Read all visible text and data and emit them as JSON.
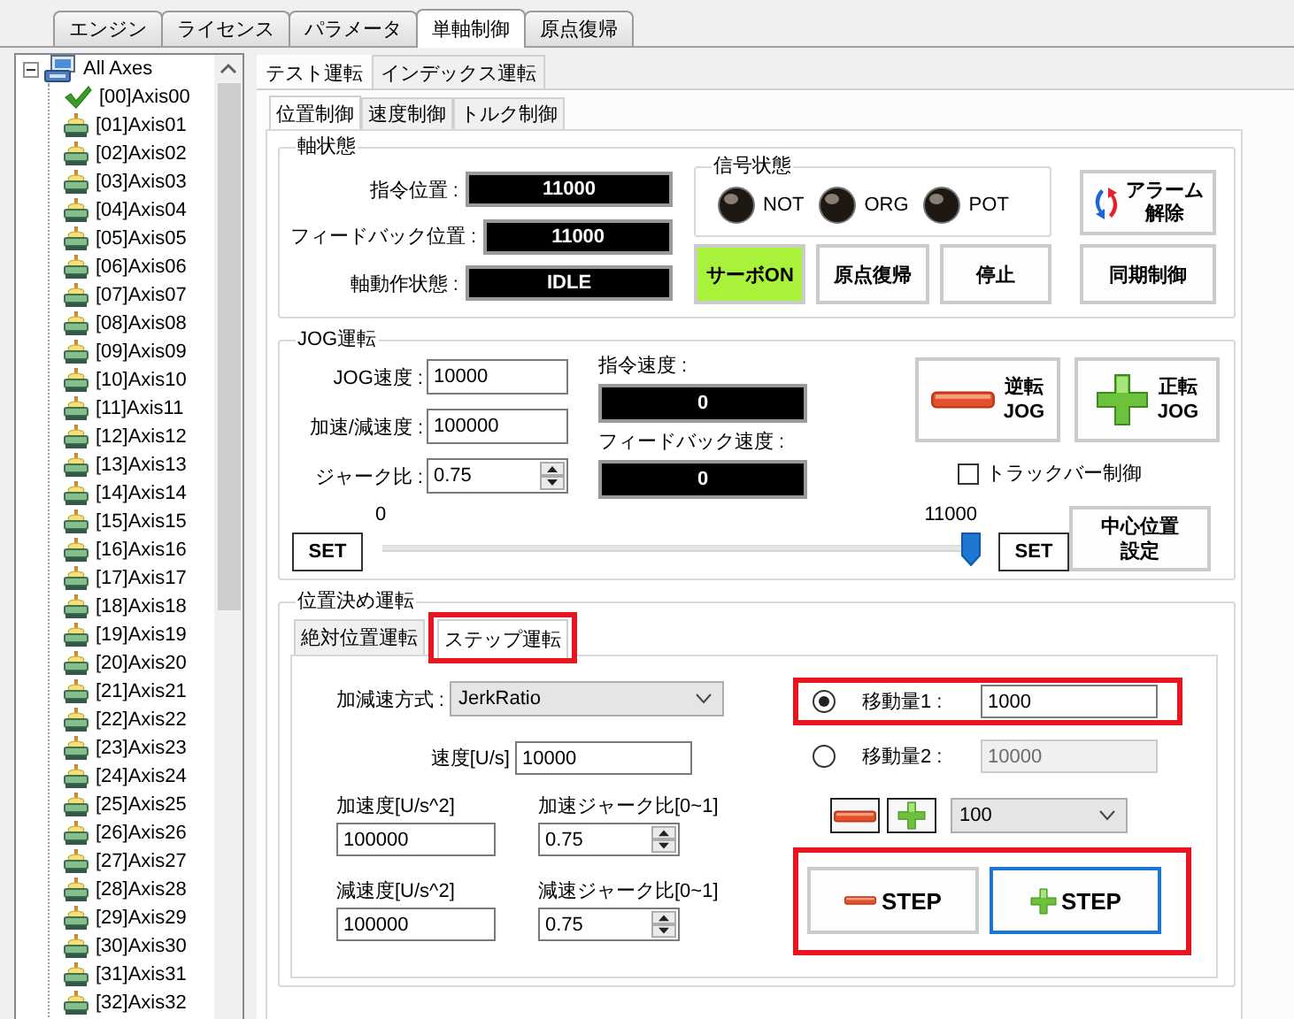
{
  "main_tabs": [
    {
      "label": "エンジン",
      "selected": false
    },
    {
      "label": "ライセンス",
      "selected": false
    },
    {
      "label": "パラメータ",
      "selected": false
    },
    {
      "label": "単軸制御",
      "selected": true
    },
    {
      "label": "原点復帰",
      "selected": false
    }
  ],
  "axis_tree": {
    "label": "All Axes",
    "expanded": true,
    "children": [
      {
        "label": "[00]Axis00",
        "kind": "active"
      },
      {
        "label": "[01]Axis01",
        "kind": "axis"
      },
      {
        "label": "[02]Axis02",
        "kind": "axis"
      },
      {
        "label": "[03]Axis03",
        "kind": "axis"
      },
      {
        "label": "[04]Axis04",
        "kind": "axis"
      },
      {
        "label": "[05]Axis05",
        "kind": "axis"
      },
      {
        "label": "[06]Axis06",
        "kind": "axis"
      },
      {
        "label": "[07]Axis07",
        "kind": "axis"
      },
      {
        "label": "[08]Axis08",
        "kind": "axis"
      },
      {
        "label": "[09]Axis09",
        "kind": "axis"
      },
      {
        "label": "[10]Axis10",
        "kind": "axis"
      },
      {
        "label": "[11]Axis11",
        "kind": "axis"
      },
      {
        "label": "[12]Axis12",
        "kind": "axis"
      },
      {
        "label": "[13]Axis13",
        "kind": "axis"
      },
      {
        "label": "[14]Axis14",
        "kind": "axis"
      },
      {
        "label": "[15]Axis15",
        "kind": "axis"
      },
      {
        "label": "[16]Axis16",
        "kind": "axis"
      },
      {
        "label": "[17]Axis17",
        "kind": "axis"
      },
      {
        "label": "[18]Axis18",
        "kind": "axis"
      },
      {
        "label": "[19]Axis19",
        "kind": "axis"
      },
      {
        "label": "[20]Axis20",
        "kind": "axis"
      },
      {
        "label": "[21]Axis21",
        "kind": "axis"
      },
      {
        "label": "[22]Axis22",
        "kind": "axis"
      },
      {
        "label": "[23]Axis23",
        "kind": "axis"
      },
      {
        "label": "[24]Axis24",
        "kind": "axis"
      },
      {
        "label": "[25]Axis25",
        "kind": "axis"
      },
      {
        "label": "[26]Axis26",
        "kind": "axis"
      },
      {
        "label": "[27]Axis27",
        "kind": "axis"
      },
      {
        "label": "[28]Axis28",
        "kind": "axis"
      },
      {
        "label": "[29]Axis29",
        "kind": "axis"
      },
      {
        "label": "[30]Axis30",
        "kind": "axis"
      },
      {
        "label": "[31]Axis31",
        "kind": "axis"
      },
      {
        "label": "[32]Axis32",
        "kind": "axis"
      }
    ]
  },
  "mode_tabs": [
    {
      "label": "テスト運転",
      "selected": true
    },
    {
      "label": "インデックス運転",
      "selected": false
    }
  ],
  "control_tabs": [
    {
      "label": "位置制御",
      "selected": true
    },
    {
      "label": "速度制御",
      "selected": false
    },
    {
      "label": "トルク制御",
      "selected": false
    }
  ],
  "axis_status": {
    "title": "軸状態",
    "readouts": [
      {
        "label": "指令位置 :",
        "value": "11000"
      },
      {
        "label": "フィードバック位置 :",
        "value": "11000"
      },
      {
        "label": "軸動作状態 :",
        "value": "IDLE"
      }
    ],
    "signals": {
      "title": "信号状態",
      "lamps": [
        {
          "label": "NOT",
          "on": false
        },
        {
          "label": "ORG",
          "on": false
        },
        {
          "label": "POT",
          "on": false
        }
      ]
    },
    "buttons": [
      {
        "label": "サーボON",
        "on": true
      },
      {
        "label": "原点復帰",
        "on": false
      },
      {
        "label": "停止",
        "on": false
      }
    ],
    "alarm_button": {
      "lines": [
        "アラーム",
        "解除"
      ]
    },
    "sync_button": {
      "label": "同期制御"
    }
  },
  "jog": {
    "title": "JOG運転",
    "fields": [
      {
        "label": "JOG速度 :",
        "value": "10000",
        "kind": "text"
      },
      {
        "label": "加速/減速度 :",
        "value": "100000",
        "kind": "text"
      },
      {
        "label": "ジャーク比 :",
        "value": "0.75",
        "kind": "spin"
      }
    ],
    "readouts": [
      {
        "label": "指令速度 :",
        "value": "0"
      },
      {
        "label": "フィードバック速度 :",
        "value": "0"
      }
    ],
    "jog_buttons": [
      {
        "kind": "reverse",
        "lines": [
          "逆転",
          "JOG"
        ]
      },
      {
        "kind": "forward",
        "lines": [
          "正転",
          "JOG"
        ]
      }
    ],
    "trackbar_control": {
      "label": "トラックバー制御",
      "checked": false
    },
    "slider": {
      "min_label": "0",
      "max_label": "11000",
      "level": 0.99
    },
    "set_buttons": [
      "SET",
      "SET"
    ],
    "center_button": {
      "lines": [
        "中心位置",
        "設定"
      ]
    }
  },
  "positioning": {
    "title": "位置決め運転",
    "tabs": [
      {
        "label": "絶対位置運転",
        "selected": false,
        "highlighted": false
      },
      {
        "label": "ステップ運転",
        "selected": true,
        "highlighted": true
      }
    ],
    "accel_mode": {
      "label": "加減速方式 :",
      "value": "JerkRatio"
    },
    "speed": {
      "label": "速度[U/s]",
      "value": "10000"
    },
    "accel": {
      "label": "加速度[U/s^2]",
      "value": "100000"
    },
    "accel_jerk": {
      "label": "加速ジャーク比[0~1]",
      "value": "0.75"
    },
    "decel": {
      "label": "減速度[U/s^2]",
      "value": "100000"
    },
    "decel_jerk": {
      "label": "減速ジャーク比[0~1]",
      "value": "0.75"
    },
    "moves": [
      {
        "label": "移動量1 :",
        "value": "1000",
        "selected": true,
        "disabled": false,
        "highlighted": true
      },
      {
        "label": "移動量2 :",
        "value": "10000",
        "selected": false,
        "disabled": true,
        "highlighted": false
      }
    ],
    "increment": {
      "value": "100"
    },
    "step_buttons": {
      "highlighted": true,
      "buttons": [
        {
          "kind": "minus",
          "label": "STEP",
          "focused": false
        },
        {
          "kind": "plus",
          "label": "STEP",
          "focused": true
        }
      ]
    }
  }
}
